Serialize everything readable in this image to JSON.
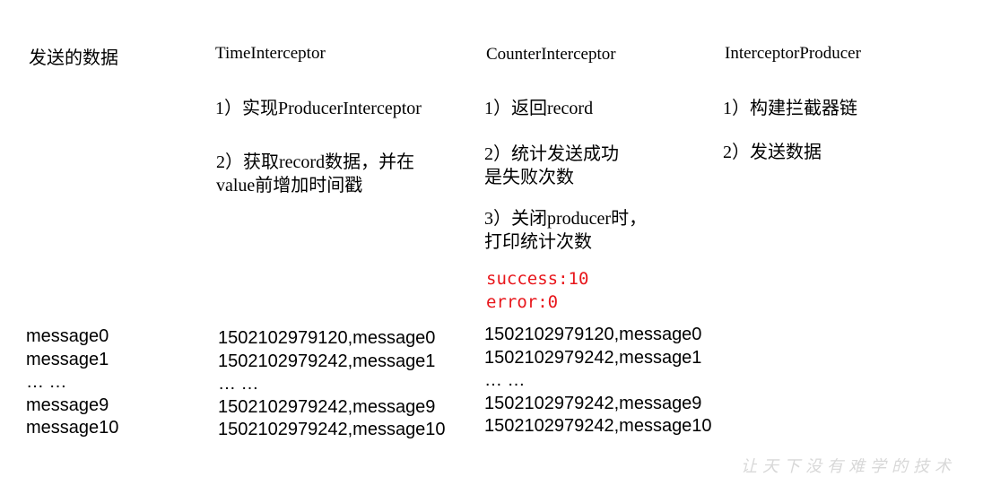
{
  "columns": {
    "data": {
      "header": "发送的数据",
      "messages": [
        "message0",
        "message1",
        "… …",
        "message9",
        "message10"
      ]
    },
    "time": {
      "header": "TimeInterceptor",
      "step1": "1）实现ProducerInterceptor",
      "step2_line1": "2）获取record数据，并在",
      "step2_line2": "value前增加时间戳",
      "messages": [
        "1502102979120,message0",
        "1502102979242,message1",
        "… …",
        "1502102979242,message9",
        "1502102979242,message10"
      ]
    },
    "counter": {
      "header": "CounterInterceptor",
      "step1": "1）返回record",
      "step2_line1": "2）统计发送成功",
      "step2_line2": "是失败次数",
      "step3_line1": "3）关闭producer时，",
      "step3_line2": "打印统计次数",
      "output_line1": "success:10",
      "output_line2": "error:0",
      "output_color": "#e8161b",
      "messages": [
        "1502102979120,message0",
        "1502102979242,message1",
        "… …",
        "1502102979242,message9",
        "1502102979242,message10"
      ]
    },
    "producer": {
      "header": "InterceptorProducer",
      "step1": "1）构建拦截器链",
      "step2": "2）发送数据"
    }
  },
  "watermark": "让天下没有难学的技术"
}
